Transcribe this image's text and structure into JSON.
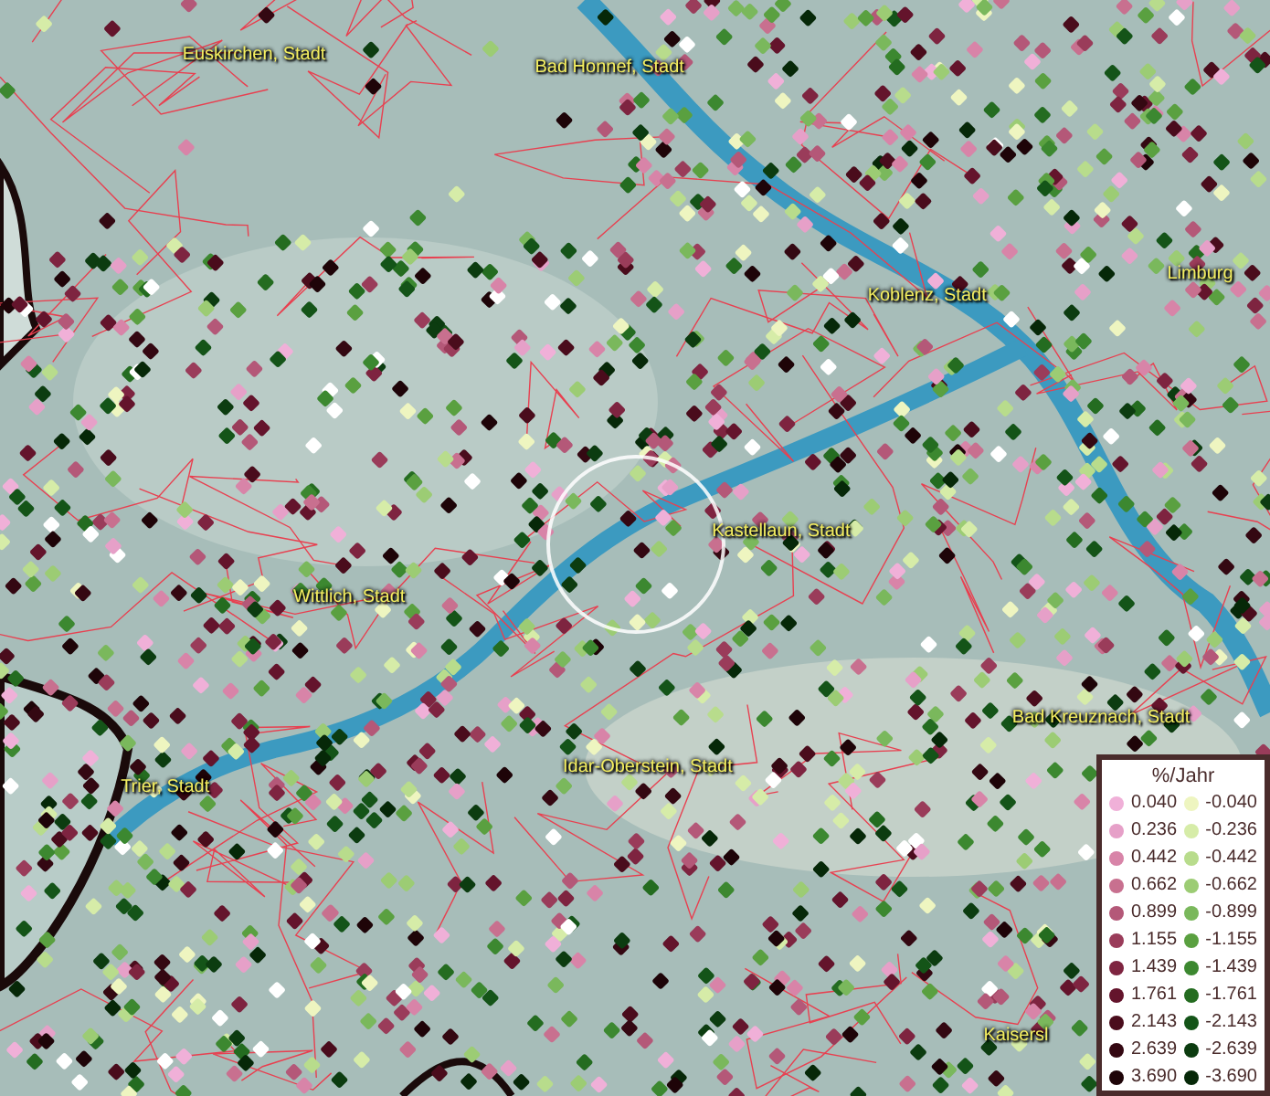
{
  "place_labels": [
    {
      "text": "Euskirchen, Stadt"
    },
    {
      "text": "Bad Honnef, Stadt"
    },
    {
      "text": "Koblenz, Stadt"
    },
    {
      "text": "Limburg"
    },
    {
      "text": "Kastellaun, Stadt"
    },
    {
      "text": "Wittlich, Stadt"
    },
    {
      "text": "Bad Kreuznach, Stadt"
    },
    {
      "text": "Trier, Stadt"
    },
    {
      "text": "Idar-Oberstein, Stadt"
    },
    {
      "text": "Kaisersl"
    }
  ],
  "legend": {
    "title": "%/Jahr",
    "positive": [
      {
        "label": "0.040",
        "color": "#f0b0d8"
      },
      {
        "label": "0.236",
        "color": "#e6a0c8"
      },
      {
        "label": "0.442",
        "color": "#d884a8"
      },
      {
        "label": "0.662",
        "color": "#c8708f"
      },
      {
        "label": "0.899",
        "color": "#b45878"
      },
      {
        "label": "1.155",
        "color": "#9a3c5a"
      },
      {
        "label": "1.439",
        "color": "#7e2440"
      },
      {
        "label": "1.761",
        "color": "#64142c"
      },
      {
        "label": "2.143",
        "color": "#4a0c1c"
      },
      {
        "label": "2.639",
        "color": "#340812"
      },
      {
        "label": "3.690",
        "color": "#1e0408"
      }
    ],
    "negative": [
      {
        "label": "-0.040",
        "color": "#eef5c0"
      },
      {
        "label": "-0.236",
        "color": "#d6eca8"
      },
      {
        "label": "-0.442",
        "color": "#b8dc8c"
      },
      {
        "label": "-0.662",
        "color": "#9ccc74"
      },
      {
        "label": "-0.899",
        "color": "#7ab85c"
      },
      {
        "label": "-1.155",
        "color": "#5aa040"
      },
      {
        "label": "-1.439",
        "color": "#3c8830"
      },
      {
        "label": "-1.761",
        "color": "#246c20"
      },
      {
        "label": "-2.143",
        "color": "#145418"
      },
      {
        "label": "-2.639",
        "color": "#0c3c10"
      },
      {
        "label": "-3.690",
        "color": "#062808"
      }
    ]
  }
}
